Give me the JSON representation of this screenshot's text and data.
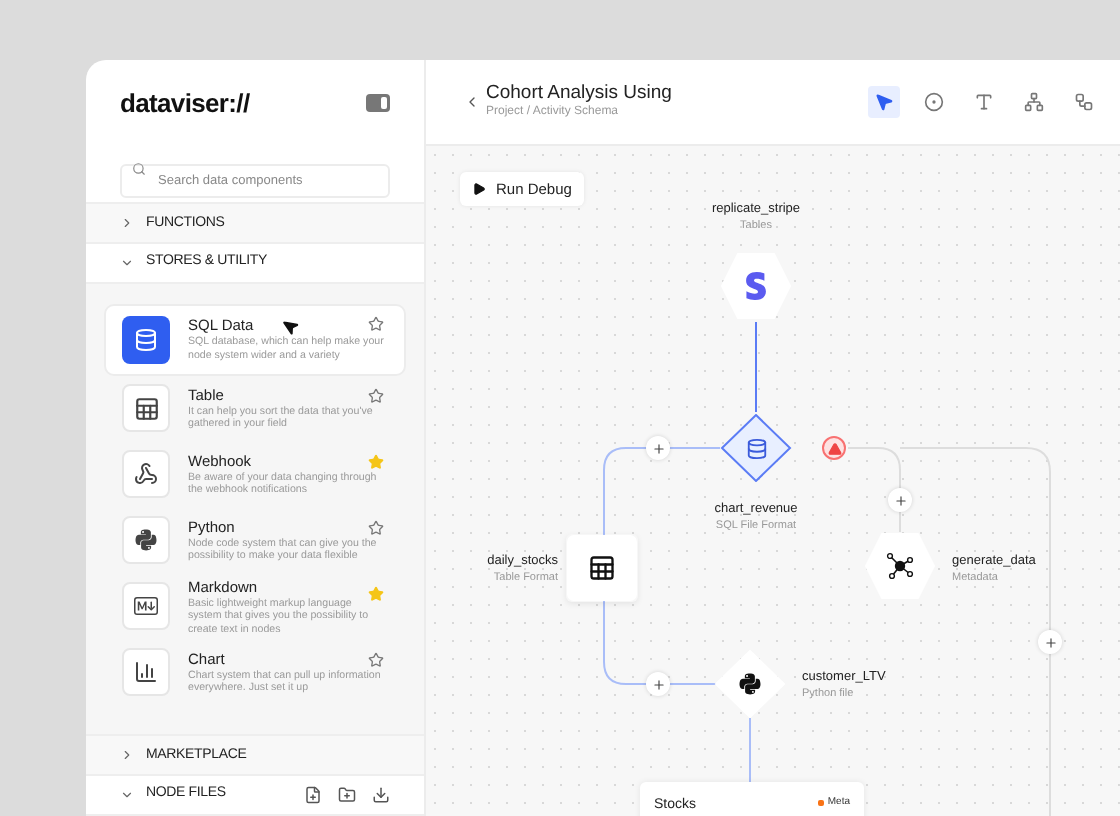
{
  "sidebar": {
    "logo": "dataviser://",
    "search": {
      "placeholder": "Search data components"
    },
    "sections": [
      {
        "label": "FUNCTIONS",
        "expanded": false
      },
      {
        "label": "STORES & UTILITY",
        "expanded": true,
        "items": [
          {
            "kind": "sql",
            "title": "SQL Data",
            "description": "SQL database, which can help make your node system wider and a variety",
            "selected": true,
            "starred": false
          },
          {
            "kind": "table",
            "title": "Table",
            "description": "It can help you sort the data that you've gathered in your field",
            "selected": false,
            "starred": false
          },
          {
            "kind": "webhook",
            "title": "Webhook",
            "description": "Be aware of your data changing through the webhook notifications",
            "selected": false,
            "starred": true
          },
          {
            "kind": "python",
            "title": "Python",
            "description": "Node code system that can give you the possibility to make your data flexible",
            "selected": false,
            "starred": false
          },
          {
            "kind": "markdown",
            "title": "Markdown",
            "description": "Basic lightweight markup language system that gives you the possibility to create text in nodes",
            "selected": false,
            "starred": true
          },
          {
            "kind": "chart",
            "title": "Chart",
            "description": "Chart system that can pull up information everywhere. Just set it up",
            "selected": false,
            "starred": false
          }
        ]
      },
      {
        "label": "MARKETPLACE",
        "expanded": false
      },
      {
        "label": "NODE FILES",
        "expanded": true
      }
    ]
  },
  "header": {
    "title": "Cohort Analysis Using",
    "breadcrumb": "Project / Activity Schema",
    "tools": [
      {
        "kind": "pointer",
        "selected": true
      },
      {
        "kind": "circle",
        "selected": false
      },
      {
        "kind": "text",
        "selected": false
      },
      {
        "kind": "network",
        "selected": false
      },
      {
        "kind": "workflow",
        "selected": false
      }
    ]
  },
  "canvas": {
    "run_button": "Run Debug",
    "nodes": [
      {
        "kind": "stripe",
        "name": "replicate_stripe",
        "subtitle": "Tables",
        "selected": false
      },
      {
        "kind": "sql",
        "name": "chart_revenue",
        "subtitle": "SQL File Format",
        "selected": true,
        "error": true
      },
      {
        "kind": "table",
        "name": "daily_stocks",
        "subtitle": "Table Format",
        "selected": false
      },
      {
        "kind": "network",
        "name": "generate_data",
        "subtitle": "Metadata",
        "selected": false
      },
      {
        "kind": "python",
        "name": "customer_LTV",
        "subtitle": "Python file",
        "selected": false
      }
    ],
    "card": {
      "title": "Stocks",
      "tag": {
        "label": "Meta",
        "color": "#f97316"
      }
    }
  }
}
